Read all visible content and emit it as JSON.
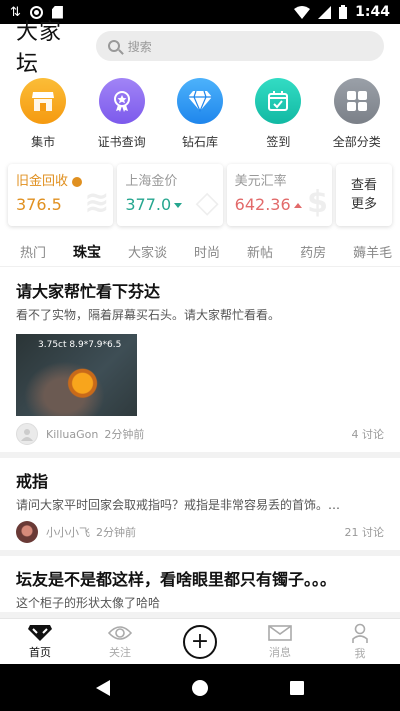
{
  "status_bar": {
    "time": "1:44"
  },
  "header": {
    "logo": "大家坛",
    "search_placeholder": "搜索"
  },
  "quick_links": [
    {
      "label": "集市",
      "color": "#f7a51b",
      "icon": "shop-icon"
    },
    {
      "label": "证书查询",
      "color": "#8e6cf0",
      "icon": "certificate-icon"
    },
    {
      "label": "钻石库",
      "color": "#2f9df3",
      "icon": "diamond-icon"
    },
    {
      "label": "签到",
      "color": "#1ec9b3",
      "icon": "calendar-check-icon"
    },
    {
      "label": "全部分类",
      "color": "#8a8f98",
      "icon": "grid-icon"
    }
  ],
  "markets": [
    {
      "title": "旧金回收",
      "value": "376.5",
      "trend": "",
      "accent": "#e09020"
    },
    {
      "title": "上海金价",
      "value": "377.0",
      "trend": "down",
      "accent": "#26a68f"
    },
    {
      "title": "美元汇率",
      "value": "642.36",
      "trend": "up",
      "accent": "#e26a6a"
    }
  ],
  "markets_more": "查看更多",
  "tabs": [
    "热门",
    "珠宝",
    "大家谈",
    "时尚",
    "新帖",
    "药房",
    "薅羊毛"
  ],
  "active_tab": "珠宝",
  "posts": [
    {
      "title": "请大家帮忙看下芬达",
      "body": "看不了实物，隔着屏幕买石头。请大家帮忙看看。",
      "image_caption": "3.75ct  8.9*7.9*6.5",
      "user": "KilluaGon",
      "time": "2分钟前",
      "comments": "4  讨论"
    },
    {
      "title": "戒指",
      "body": "请问大家平时回家会取戒指吗？戒指是非常容易丢的首饰。…",
      "user": "小小小飞",
      "time": "2分钟前",
      "comments": "21  讨论"
    },
    {
      "title": "坛友是不是都这样，看啥眼里都只有镯子。。。",
      "body": "这个柜子的形状太像了哈哈",
      "user": "",
      "time": "",
      "comments": ""
    }
  ],
  "bottom_nav": [
    {
      "label": "首页",
      "icon": "home-icon",
      "active": true
    },
    {
      "label": "关注",
      "icon": "eye-icon",
      "active": false
    },
    {
      "label": "",
      "icon": "add-icon",
      "active": false
    },
    {
      "label": "消息",
      "icon": "mail-icon",
      "active": false
    },
    {
      "label": "我",
      "icon": "user-icon",
      "active": false
    }
  ]
}
